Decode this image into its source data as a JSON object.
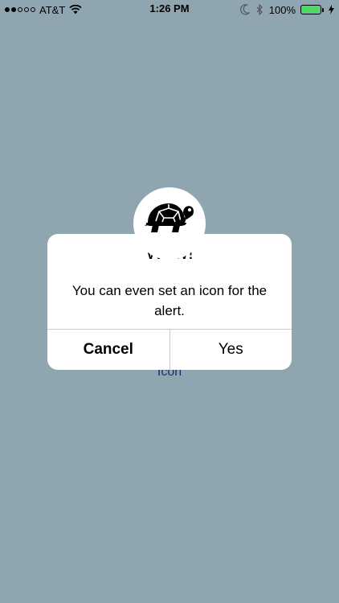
{
  "status_bar": {
    "carrier": "AT&T",
    "time": "1:26 PM",
    "battery_percent": "100%",
    "signal_dots": [
      "filled",
      "filled",
      "empty",
      "empty",
      "empty"
    ],
    "battery_color": "#4cd964"
  },
  "background": {
    "color": "#8fa5b0",
    "button_label": "Icon"
  },
  "alert": {
    "icon": "turtle-icon",
    "title": "Wow!",
    "message": "You can even set an icon for the alert.",
    "actions": [
      {
        "label": "Cancel",
        "style": "bold"
      },
      {
        "label": "Yes",
        "style": "normal"
      }
    ]
  }
}
